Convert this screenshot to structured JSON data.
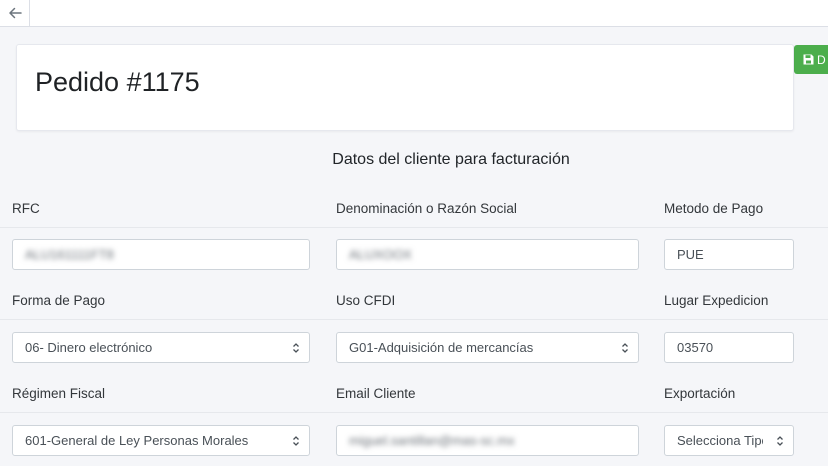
{
  "order": {
    "title": "Pedido #1175"
  },
  "actions": {
    "green_label": "D"
  },
  "section": {
    "title": "Datos del cliente para facturación"
  },
  "fields": {
    "rfc": {
      "label": "RFC",
      "value": "ALU161111FT8"
    },
    "razon_social": {
      "label": "Denominación o Razón Social",
      "value": "ALUXOOX"
    },
    "metodo_pago": {
      "label": "Metodo de Pago",
      "value": "PUE"
    },
    "forma_pago": {
      "label": "Forma de Pago",
      "value": "06- Dinero electrónico"
    },
    "uso_cfdi": {
      "label": "Uso CFDI",
      "value": "G01-Adquisición de mercancías"
    },
    "lugar_expedicion": {
      "label": "Lugar Expedicion",
      "value": "03570"
    },
    "regimen_fiscal": {
      "label": "Régimen Fiscal",
      "value": "601-General de Ley Personas Morales"
    },
    "email_cliente": {
      "label": "Email Cliente",
      "value": "miguel.santillan@mas-sc.mx"
    },
    "exportacion": {
      "label": "Exportación",
      "value": "Selecciona Tipo"
    }
  },
  "icons": {
    "back": "arrow-left-icon",
    "save": "floppy-disk-icon",
    "caret": "select-caret-icon"
  },
  "colors": {
    "green": "#4cae4c",
    "background": "#f5f6f9"
  }
}
